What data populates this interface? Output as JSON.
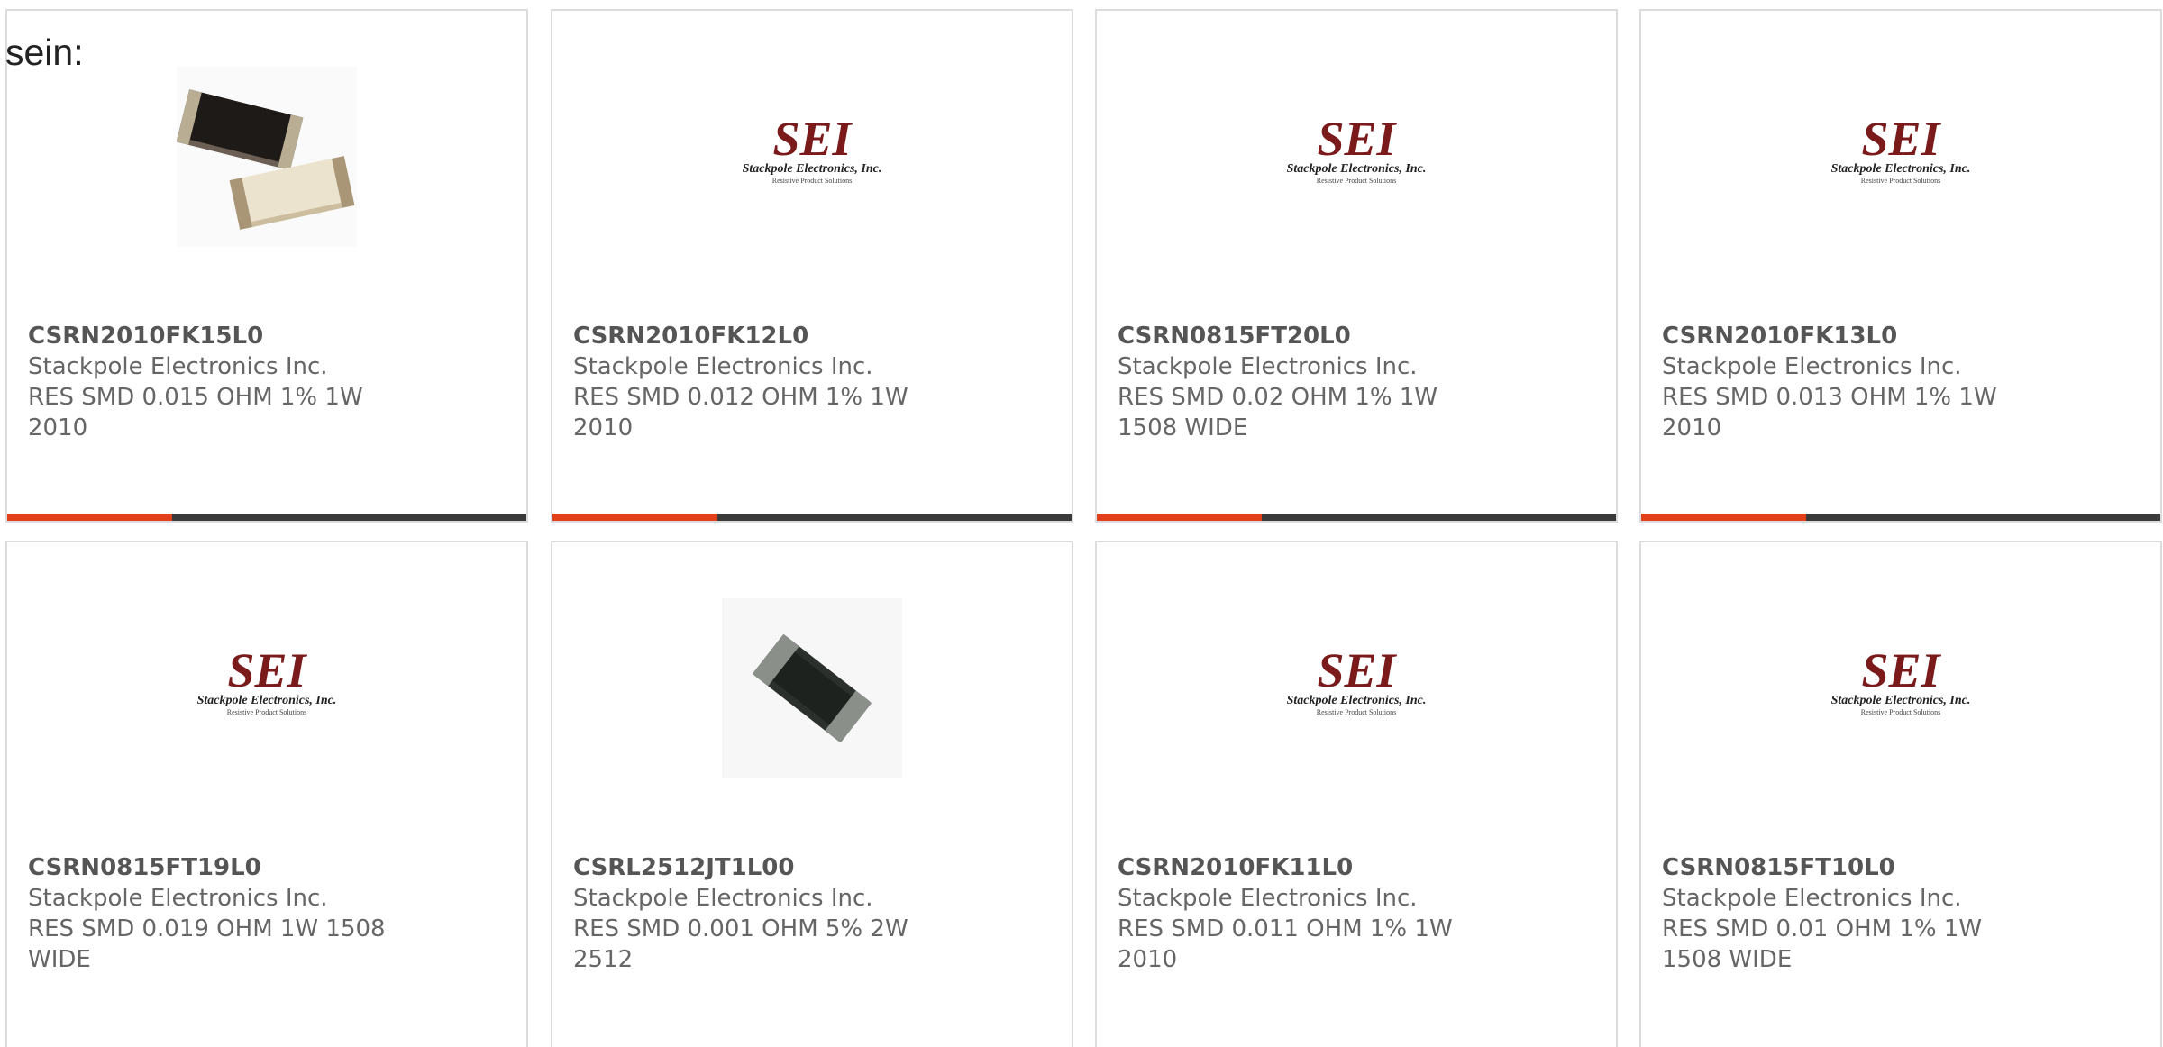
{
  "intro_text": "sein:",
  "colors": {
    "accent": "#e1401a",
    "bar_dark": "#3a3a3a",
    "logo_red": "#7a1a1a"
  },
  "logo": {
    "main": "SEI",
    "company": "Stackpole Electronics, Inc.",
    "tagline": "Resistive Product Solutions"
  },
  "products": [
    {
      "part": "CSRN2010FK15L0",
      "manufacturer": "Stackpole Electronics Inc.",
      "description": "RES SMD 0.015 OHM 1% 1W 2010",
      "image": "resistor-pair-photo"
    },
    {
      "part": "CSRN2010FK12L0",
      "manufacturer": "Stackpole Electronics Inc.",
      "description": "RES SMD 0.012 OHM 1% 1W 2010",
      "image": "sei-logo"
    },
    {
      "part": "CSRN0815FT20L0",
      "manufacturer": "Stackpole Electronics Inc.",
      "description": "RES SMD 0.02 OHM 1% 1W 1508 WIDE",
      "image": "sei-logo"
    },
    {
      "part": "CSRN2010FK13L0",
      "manufacturer": "Stackpole Electronics Inc.",
      "description": "RES SMD 0.013 OHM 1% 1W 2010",
      "image": "sei-logo"
    },
    {
      "part": "CSRN0815FT19L0",
      "manufacturer": "Stackpole Electronics Inc.",
      "description": "RES SMD 0.019 OHM 1W 1508 WIDE",
      "image": "sei-logo"
    },
    {
      "part": "CSRL2512JT1L00",
      "manufacturer": "Stackpole Electronics Inc.",
      "description": "RES SMD 0.001 OHM 5% 2W 2512",
      "image": "resistor-chip-photo"
    },
    {
      "part": "CSRN2010FK11L0",
      "manufacturer": "Stackpole Electronics Inc.",
      "description": "RES SMD 0.011 OHM 1% 1W 2010",
      "image": "sei-logo"
    },
    {
      "part": "CSRN0815FT10L0",
      "manufacturer": "Stackpole Electronics Inc.",
      "description": "RES SMD 0.01 OHM 1% 1W 1508 WIDE",
      "image": "sei-logo"
    }
  ]
}
